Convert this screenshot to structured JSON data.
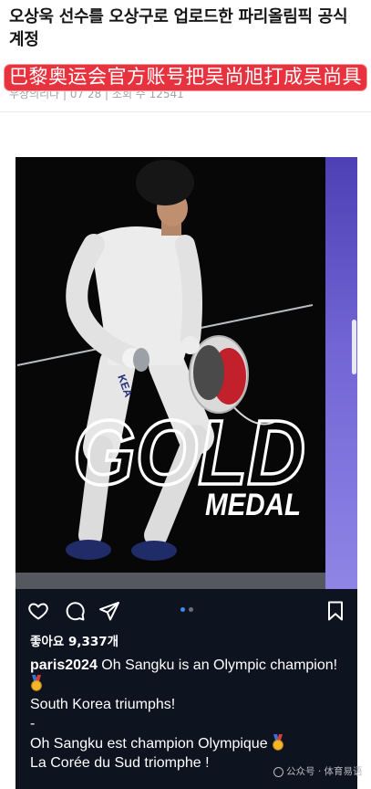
{
  "article": {
    "headline": "오상욱 선수를 오상구로 업로드한 파리올림픽 공식 계정",
    "meta": "우상의리나 | 07 28 | 조회 수 12541"
  },
  "banner": {
    "text": "巴黎奥运会官方账号把吴尚旭打成吴尚具"
  },
  "post": {
    "photo": {
      "title_word": "GOLD",
      "subtitle_word": "MEDAL",
      "uniform_text": "KEA"
    },
    "carousel": {
      "current": 1,
      "total": 2
    },
    "actions": {
      "like": "heart-icon",
      "comment": "comment-icon",
      "share": "paper-plane-icon",
      "save": "bookmark-icon"
    },
    "likes": "좋아요 9,337개",
    "caption": {
      "username": "paris2024",
      "lines": [
        "Oh Sangku is an Olympic champion!",
        "South Korea triumphs!",
        "-",
        "Oh Sangku est champion Olympique",
        "La Corée du Sud triomphe !"
      ],
      "emoji_icon": "gold-medal-icon"
    }
  },
  "watermark": {
    "text": "公众号 · 体育易语",
    "icon": "wechat-icon"
  },
  "colors": {
    "banner_red": "#e8333e",
    "post_background": "#0e1320",
    "photo_background": "#070707",
    "carousel_active": "#3b8cf0",
    "carousel_inactive": "#6b6f7a",
    "next_slide_purple": "#7365d5"
  }
}
